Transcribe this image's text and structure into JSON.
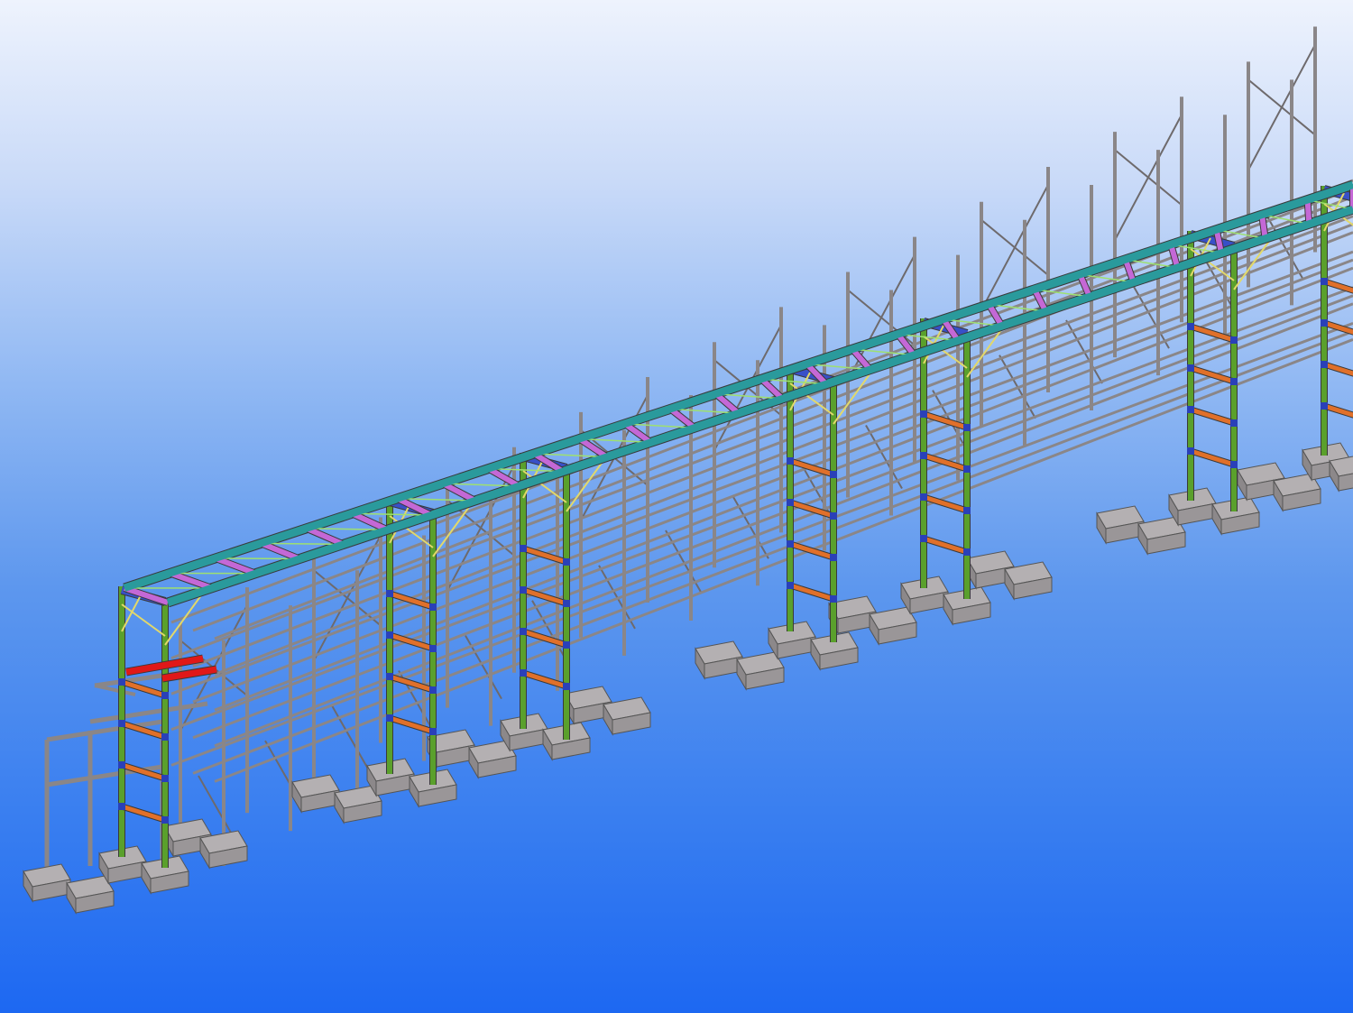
{
  "viewport": {
    "background_top": "#eef3fd",
    "background_bottom": "#1d68f2"
  },
  "model": {
    "description_colors": {
      "steel_grey": "#8a8688",
      "steel_grey_dark": "#6e6a6c",
      "concrete_footing": "#9a9698",
      "column_green": "#5aa02c",
      "truss_chord_teal": "#2a9a9c",
      "purlin_magenta": "#c468d6",
      "beam_blue": "#3850c8",
      "beam_orange": "#e0702a",
      "beam_red": "#e01818",
      "bracing_yellow": "#e2d86a",
      "connection_blue": "#2a40b8",
      "bracing_green": "#9ee070"
    }
  }
}
